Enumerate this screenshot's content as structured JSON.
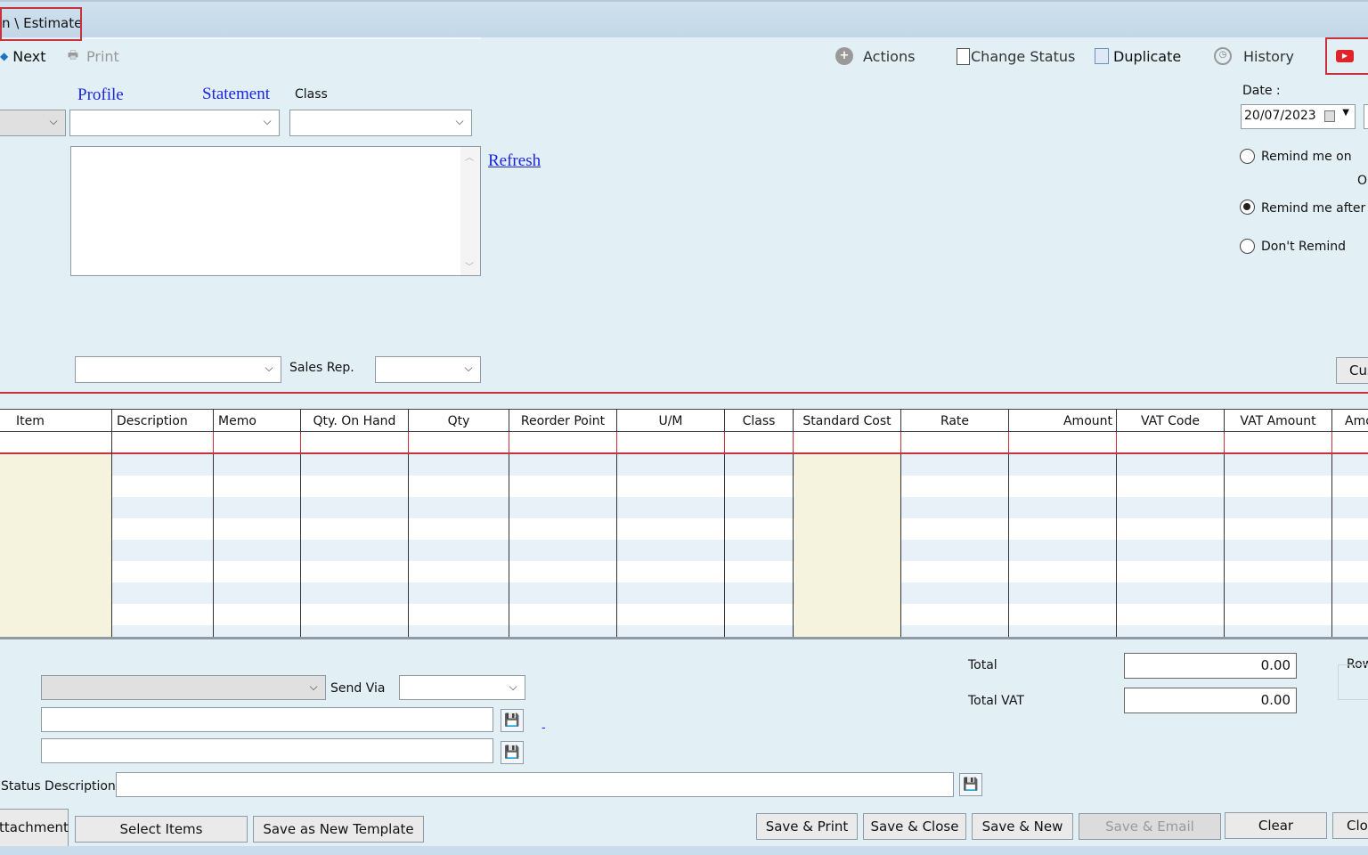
{
  "breadcrumb": "n \\ Estimate",
  "toolbar": {
    "next_label": "Next",
    "print_label": "Print",
    "actions_label": "Actions",
    "change_status_label": "Change Status",
    "duplicate_label": "Duplicate",
    "history_label": "History"
  },
  "form": {
    "profile_label": "Profile",
    "statement_label": "Statement",
    "class_label": "Class",
    "refresh_label": "Refresh",
    "sales_rep_label": "Sales Rep.",
    "date_label": "Date :",
    "date_value": "20/07/2023",
    "remind_me_on": "Remind me on",
    "remind_me_after": "Remind me after",
    "dont_remind": "Don't Remind",
    "partial_letter_o": "O",
    "cus_button_partial": "Cus"
  },
  "grid": {
    "columns": [
      "Item",
      "Description",
      "Memo",
      "Qty. On Hand",
      "Qty",
      "Reorder Point",
      "U/M",
      "Class",
      "Standard Cost",
      "Rate",
      "Amount",
      "VAT Code",
      "VAT Amount",
      "Amo"
    ]
  },
  "footer": {
    "send_via_label": "Send Via",
    "total_label": "Total",
    "total_value": "0.00",
    "total_vat_label": "Total VAT",
    "total_vat_value": "0.00",
    "row_partial": "Row",
    "dash_link": "-",
    "status_description_label": "Status Description:"
  },
  "buttons": {
    "attachment": "ttachment",
    "select_items": "Select Items",
    "save_new_template": "Save as New Template",
    "save_print": "Save & Print",
    "save_close": "Save & Close",
    "save_new": "Save & New",
    "save_email": "Save & Email",
    "clear": "Clear",
    "close_partial": "Clos"
  },
  "colors": {
    "background": "#e2eff5",
    "highlight_red": "#c8323c",
    "link_blue": "#1a23e8",
    "beige_column": "#f5f3dd"
  }
}
